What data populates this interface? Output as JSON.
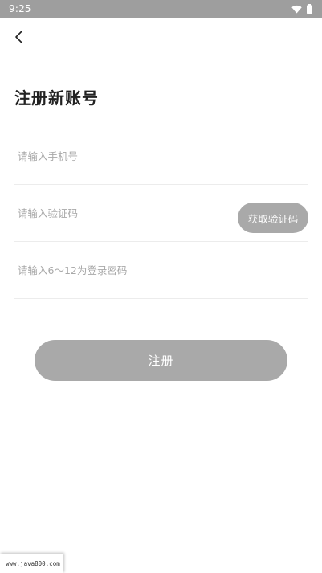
{
  "status_bar": {
    "time": "9:25",
    "icons": [
      "wifi-icon",
      "battery-icon"
    ]
  },
  "header": {
    "back_icon": "chevron-left-icon",
    "title": "注册新账号"
  },
  "form": {
    "phone": {
      "placeholder": "请输入手机号",
      "value": ""
    },
    "code": {
      "placeholder": "请输入验证码",
      "value": "",
      "send_button_label": "获取验证码"
    },
    "password": {
      "placeholder": "请输入6～12为登录密码",
      "value": ""
    }
  },
  "register_button_label": "注册",
  "watermark": "www.java800.com",
  "colors": {
    "status_bar_bg": "#9e9e9e",
    "button_bg": "#a9a9a9",
    "divider": "#ececec",
    "placeholder": "#a8a8a8"
  }
}
